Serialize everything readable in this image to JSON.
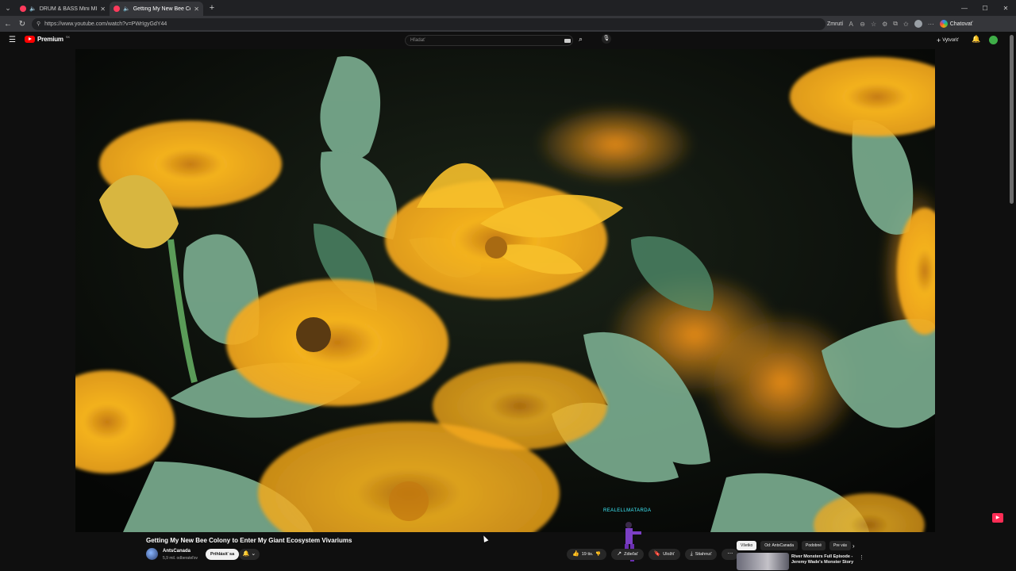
{
  "browser": {
    "tabs": [
      {
        "title": "DRUM & BASS Mini MIX 2024",
        "active": false
      },
      {
        "title": "Getting My New Bee Colony",
        "active": true
      }
    ],
    "url": "https://www.youtube.com/watch?v=PWrIgyGdY44",
    "zoom_label": "Zmrutí",
    "copilot_label": "Chatovať"
  },
  "masthead": {
    "logo_text": "Premium",
    "logo_sup": "SK",
    "search_placeholder": "Hľadať",
    "create_label": "Vytvoriť"
  },
  "overlay": {
    "streamer_tag": "REALELLMATARDA"
  },
  "video": {
    "title": "Getting My New Bee Colony to Enter My Giant Ecosystem Vivariums",
    "channel": "AntsCanada",
    "subscribers": "5,9 mil. odberateľov",
    "subscribe_label": "Prihlásiť sa",
    "likes": "19 tis.",
    "share_label": "Zdieľať",
    "save_label": "Uložiť",
    "download_label": "Stiahnuť"
  },
  "sidebar": {
    "chips": [
      "Všetko",
      "Od: AntsCanada",
      "Podobné",
      "Pre vás"
    ],
    "recommendation_title": "River Monsters Full Episode - Jeremy Wade's Monster Story"
  },
  "colors": {
    "youtube_red": "#ff0000",
    "flower_orange": "#f3a51d",
    "leaf_green": "#6fa57f"
  }
}
